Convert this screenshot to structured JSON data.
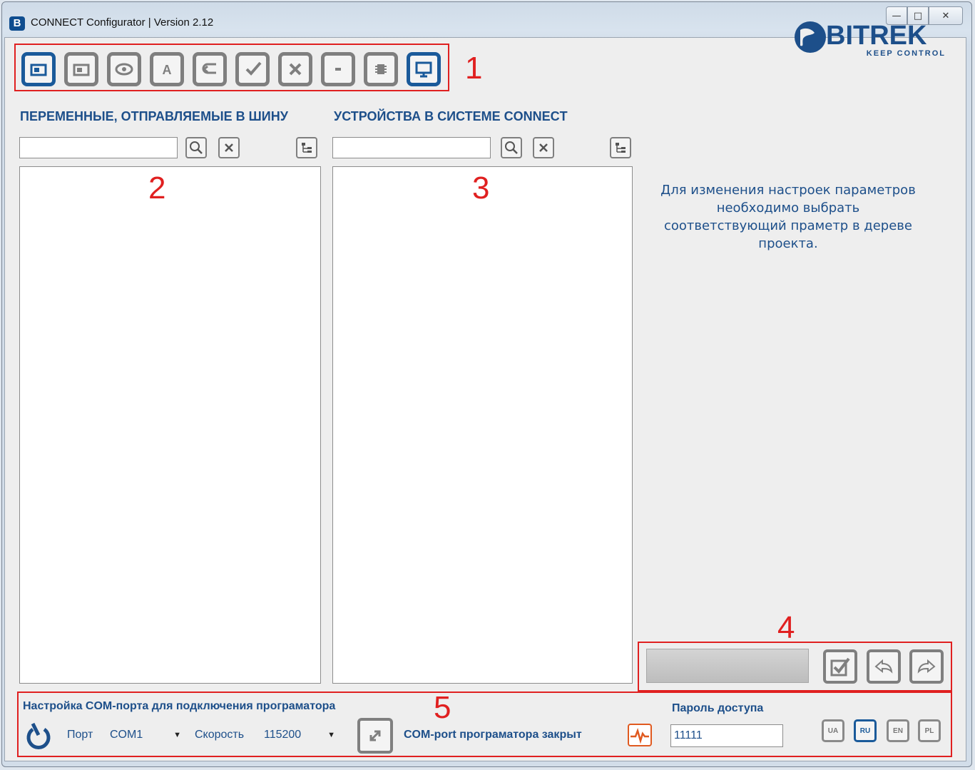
{
  "window": {
    "app_icon": "B",
    "title": "CONNECT Configurator | Version 2.12",
    "minimize": "—",
    "maximize": "□",
    "close": "✕"
  },
  "toolbar": {
    "icons": [
      "open-device-icon",
      "open-file-icon",
      "view-icon",
      "text-icon",
      "undo-icon",
      "check-icon",
      "close-x-icon",
      "minus-icon",
      "chip-icon",
      "monitor-icon"
    ],
    "annotation": "1"
  },
  "logo": {
    "text": "BITREK",
    "tagline": "KEEP CONTROL"
  },
  "left_panel": {
    "title": "ПЕРЕМЕННЫЕ, ОТПРАВЛЯЕМЫЕ В ШИНУ",
    "search_value": "",
    "annotation": "2"
  },
  "middle_panel": {
    "title": "УСТРОЙСТВА В СИСТЕМЕ CONNECT",
    "search_value": "",
    "annotation": "3"
  },
  "right_panel": {
    "hint": "Для изменения настроек параметров необходимо выбрать соответствующий праметр в дереве проекта.",
    "annotation": "4"
  },
  "com_settings": {
    "title": "Настройка COM-порта для подключения програматора",
    "annotation": "5",
    "port_label": "Порт",
    "port_value": "COM1",
    "speed_label": "Скорость",
    "speed_value": "115200",
    "status": "COM-port програматора закрыт"
  },
  "password": {
    "label": "Пароль доступа",
    "value": "11111"
  },
  "languages": [
    {
      "code": "UA",
      "active": false
    },
    {
      "code": "RU",
      "active": true
    },
    {
      "code": "EN",
      "active": false
    },
    {
      "code": "PL",
      "active": false
    }
  ],
  "colors": {
    "accent": "#1d4f8a",
    "annotation_red": "#e02020",
    "button_gray": "#7f7f7f"
  }
}
